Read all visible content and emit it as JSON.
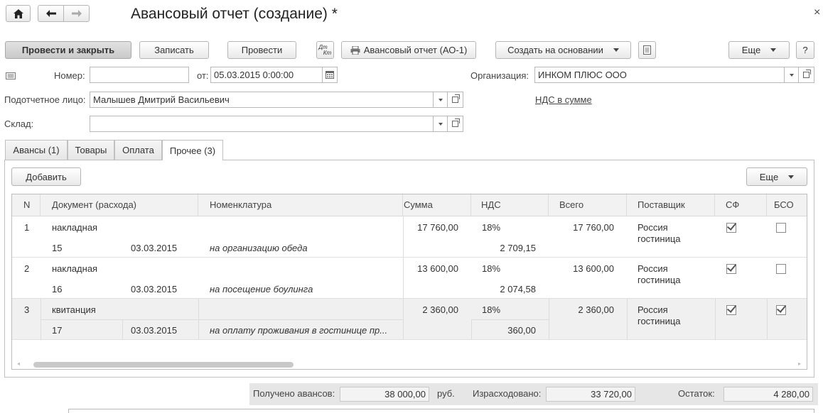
{
  "window": {
    "title": "Авансовый отчет (создание) *",
    "close": "×"
  },
  "toolbar": {
    "post_and_close": "Провести и закрыть",
    "save": "Записать",
    "post": "Провести",
    "dtkt_top": "Дт",
    "dtkt_bottom": "Кт",
    "print_report": "Авансовый отчет (АО-1)",
    "create_based_on": "Создать на основании",
    "more": "Еще",
    "help": "?"
  },
  "form": {
    "number_label": "Номер:",
    "number_value": "",
    "date_label": "от:",
    "date_value": "05.03.2015  0:00:00",
    "org_label": "Организация:",
    "org_value": "ИНКОМ ПЛЮС ООО",
    "person_label": "Подотчетное лицо:",
    "person_value": "Малышев Дмитрий Васильевич",
    "vat_link": "НДС в сумме",
    "warehouse_label": "Склад:",
    "warehouse_value": ""
  },
  "tabs": [
    {
      "label": "Авансы (1)"
    },
    {
      "label": "Товары"
    },
    {
      "label": "Оплата"
    },
    {
      "label": "Прочее (3)"
    }
  ],
  "panel": {
    "add": "Добавить",
    "more": "Еще"
  },
  "table": {
    "headers": [
      "N",
      "Документ (расхода)",
      "Номенклатура",
      "Сумма",
      "НДС",
      "Всего",
      "Поставщик",
      "СФ",
      "БСО"
    ],
    "rows": [
      {
        "n": "1",
        "doc_type": "накладная",
        "doc_num": "15",
        "doc_date": "03.03.2015",
        "item": "на организацию обеда",
        "sum": "17 760,00",
        "vat_rate": "18%",
        "vat_sum": "2 709,15",
        "total": "17 760,00",
        "supplier1": "Россия",
        "supplier2": "гостиница",
        "sf": true,
        "bso": false
      },
      {
        "n": "2",
        "doc_type": "накладная",
        "doc_num": "16",
        "doc_date": "03.03.2015",
        "item": "на посещение боулинга",
        "sum": "13 600,00",
        "vat_rate": "18%",
        "vat_sum": "2 074,58",
        "total": "13 600,00",
        "supplier1": "Россия",
        "supplier2": "гостиница",
        "sf": true,
        "bso": false
      },
      {
        "n": "3",
        "doc_type": "квитанция",
        "doc_num": "17",
        "doc_date": "03.03.2015",
        "item": "на оплату проживания в гостинице пр...",
        "sum": "2 360,00",
        "vat_rate": "18%",
        "vat_sum": "360,00",
        "total": "2 360,00",
        "supplier1": "Россия",
        "supplier2": "гостиница",
        "sf": true,
        "bso": true
      }
    ]
  },
  "footer": {
    "received_label": "Получено авансов:",
    "received_value": "38 000,00",
    "currency": "руб.",
    "spent_label": "Израсходовано:",
    "spent_value": "33 720,00",
    "balance_label": "Остаток:",
    "balance_value": "4 280,00"
  }
}
